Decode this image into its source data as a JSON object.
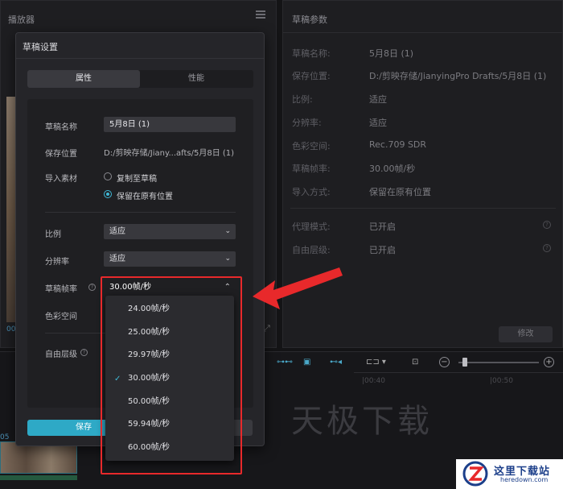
{
  "player": {
    "title": "播放器",
    "time_fragment": "00"
  },
  "params": {
    "title": "草稿参数",
    "rows": [
      {
        "label": "草稿名称:",
        "value": "5月8日 (1)"
      },
      {
        "label": "保存位置:",
        "value": "D:/剪映存储/JianyingPro Drafts/5月8日 (1)"
      },
      {
        "label": "比例:",
        "value": "适应"
      },
      {
        "label": "分辨率:",
        "value": "适应"
      },
      {
        "label": "色彩空间:",
        "value": "Rec.709 SDR"
      },
      {
        "label": "草稿帧率:",
        "value": "30.00帧/秒"
      },
      {
        "label": "导入方式:",
        "value": "保留在原有位置"
      }
    ],
    "rows2": [
      {
        "label": "代理模式:",
        "value": "已开启"
      },
      {
        "label": "自由层级:",
        "value": "已开启"
      }
    ],
    "modify_label": "修改"
  },
  "timeline": {
    "time_marks": [
      "|00:40",
      "|00:50"
    ],
    "clip_label": "05",
    "watermark": "天极下载"
  },
  "dialog": {
    "title": "草稿设置",
    "tabs": [
      "属性",
      "性能"
    ],
    "labels": {
      "name": "草稿名称",
      "path": "保存位置",
      "import": "导入素材",
      "ratio": "比例",
      "resolution": "分辨率",
      "framerate": "草稿帧率",
      "colorspace": "色彩空间",
      "layer": "自由层级"
    },
    "name_value": "5月8日 (1)",
    "path_value": "D:/剪映存储/Jiany...afts/5月8日 (1)",
    "import_options": [
      "复制至草稿",
      "保留在原有位置"
    ],
    "import_selected": "保留在原有位置",
    "ratio_value": "适应",
    "resolution_value": "适应",
    "framerate_value": "30.00帧/秒",
    "save_label": "保存"
  },
  "framerate_options": [
    "24.00帧/秒",
    "25.00帧/秒",
    "29.97帧/秒",
    "30.00帧/秒",
    "50.00帧/秒",
    "59.94帧/秒",
    "60.00帧/秒"
  ],
  "framerate_selected": "30.00帧/秒",
  "logo": {
    "text": "这里下载站",
    "sub": "heredown.com"
  },
  "colors": {
    "accent": "#2ea9c6",
    "highlight": "#e8292b"
  }
}
